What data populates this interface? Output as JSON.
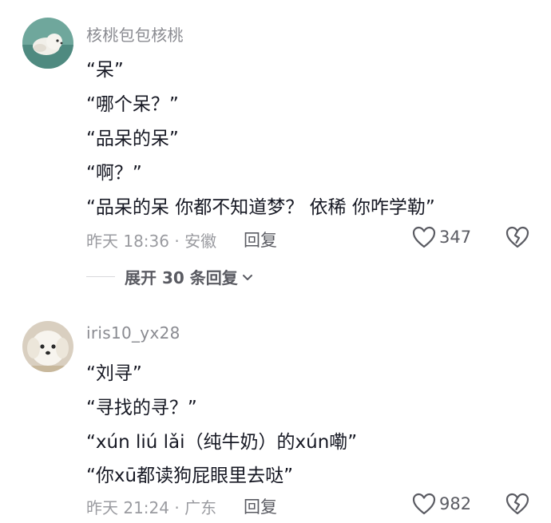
{
  "comments": [
    {
      "username": "核桃包包核桃",
      "lines": [
        "“呆”",
        "“哪个呆？”",
        "“品呆的呆”",
        "“啊？”",
        "“品呆的呆 你都不知道梦？ 依稀 你咋学勒”"
      ],
      "meta": "昨天 18:36 · 安徽",
      "reply_label": "回复",
      "likes": "347",
      "expand_label": "展开 30 条回复"
    },
    {
      "username": "iris10_yx28",
      "lines": [
        "“刘寻”",
        "“寻找的寻？”",
        "“xún liú lǎi（纯牛奶）的xún嘞”",
        "“你xū都读狗屁眼里去哒”"
      ],
      "meta": "昨天 21:24 · 广东",
      "reply_label": "回复",
      "likes": "982"
    }
  ],
  "icons": {
    "like": "heart-outline-icon",
    "dislike": "broken-heart-icon",
    "expand": "chevron-down-icon"
  },
  "colors": {
    "text": "#161823",
    "secondary": "#8a8b91",
    "icon": "#5a5b62"
  }
}
